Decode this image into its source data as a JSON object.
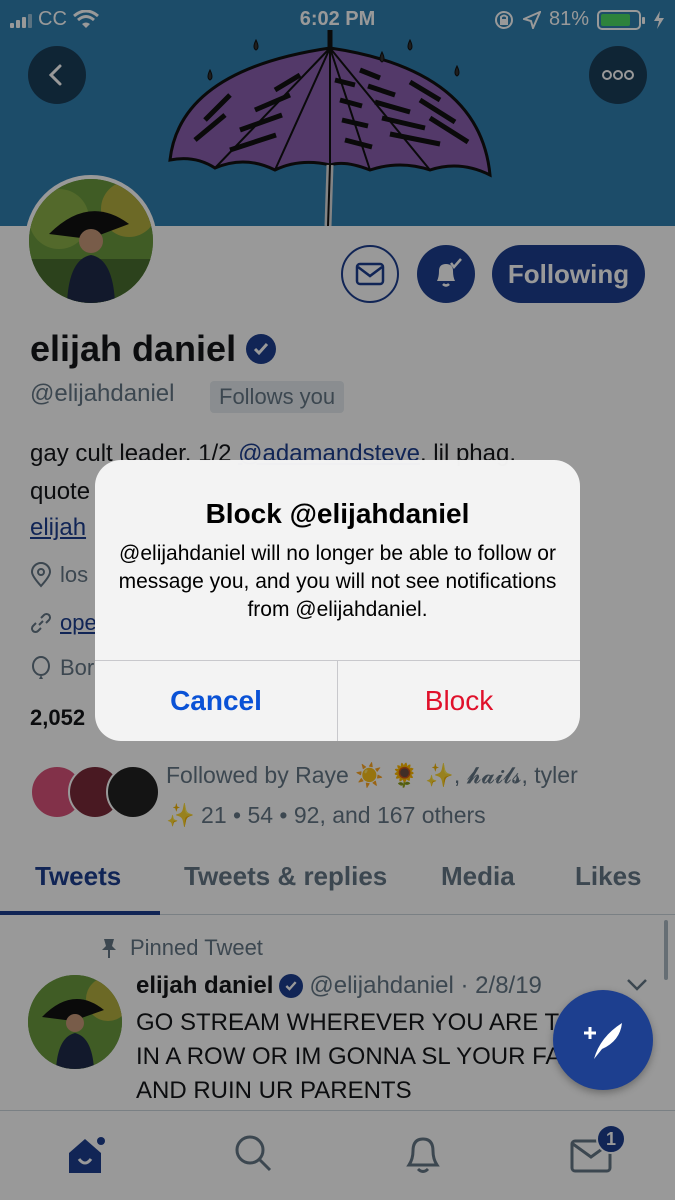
{
  "status_bar": {
    "carrier": "CC",
    "time": "6:02 PM",
    "battery_percent": "81%",
    "battery_level": 0.81
  },
  "profile": {
    "name": "elijah daniel",
    "handle": "@elijahdaniel",
    "follows_you_badge": "Follows you",
    "follow_button": "Following",
    "bio_line1_prefix": "gay cult leader. 1/2",
    "bio_mention": "@adamandsteve",
    "bio_line1_suffix": ". lil phag.",
    "bio_line2": "quote",
    "bio_link": "elijah",
    "location": "los",
    "website": "ope",
    "birth": "Bor",
    "following_count": "2,052",
    "followed_by": "Followed by Raye ☀️ 🌻 ✨, 𝓱𝓪𝓲𝓵𝓼, tyler",
    "followed_by_line2": "✨ 21 • 54 • 92, and 167 others"
  },
  "tabs": [
    {
      "label": "Tweets",
      "active": true
    },
    {
      "label": "Tweets & replies",
      "active": false
    },
    {
      "label": "Media",
      "active": false
    },
    {
      "label": "Likes",
      "active": false
    }
  ],
  "tweet": {
    "pinned_label": "Pinned Tweet",
    "author": "elijah daniel",
    "handle_date": "@elijahdaniel · 2/8/19",
    "text": "GO STREAM WHEREVER YOU ARE TIMES IN A ROW OR IM GONNA SL YOUR FATHER AND RUIN UR PARENTS"
  },
  "tab_bar": {
    "dm_badge": "1"
  },
  "alert": {
    "title": "Block @elijahdaniel",
    "message": "@elijahdaniel will no longer be able to follow or message you, and you will not see notifications from @elijahdaniel.",
    "cancel_label": "Cancel",
    "block_label": "Block"
  },
  "colors": {
    "accent": "#1d3f8f",
    "banner": "#2f7fb0",
    "destructive": "#e0112b",
    "ios_blue": "#0a52d6"
  }
}
